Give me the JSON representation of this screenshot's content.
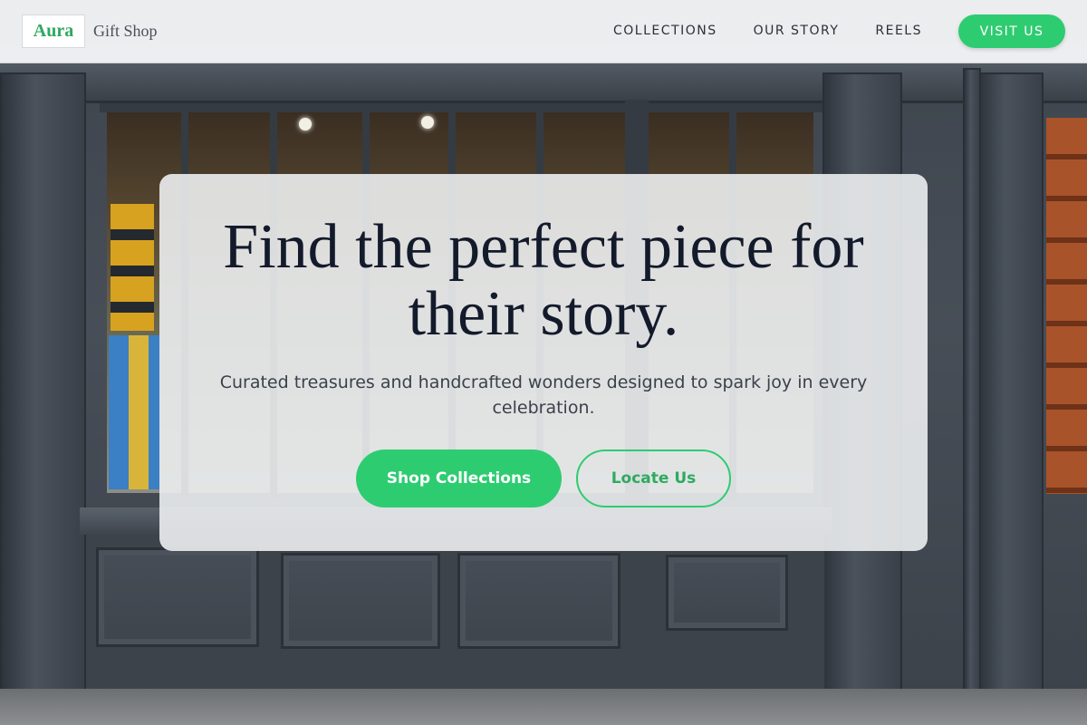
{
  "header": {
    "brand_name": "Aura",
    "brand_subtitle": "Gift Shop",
    "nav": [
      "COLLECTIONS",
      "OUR STORY",
      "REELS"
    ],
    "cta_label": "VISIT US"
  },
  "hero": {
    "title": "Find the perfect piece for their story.",
    "subtitle": "Curated treasures and handcrafted wonders designed to spark joy in every celebration.",
    "primary_button": "Shop Collections",
    "secondary_button": "Locate Us"
  },
  "colors": {
    "accent": "#2ecc71",
    "title_text": "#131a2b",
    "backdrop": "#3e444c"
  }
}
